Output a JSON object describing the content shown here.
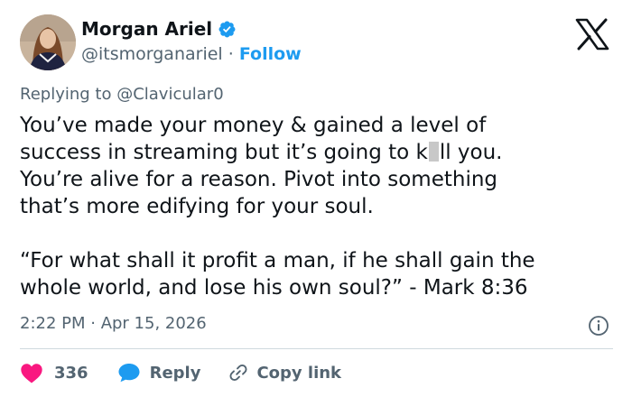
{
  "colors": {
    "accent": "#1d9bf0",
    "text": "#0f1419",
    "secondary": "#536471",
    "like": "#f91880",
    "divider": "#cfd9de"
  },
  "author": {
    "name": "Morgan Ariel",
    "handle": "@itsmorganariel",
    "separator": "·",
    "follow_label": "Follow",
    "verified_icon": "verified-badge-icon",
    "avatar_icon": "avatar"
  },
  "header": {
    "logo_icon": "x-logo-icon"
  },
  "reply_context": "Replying to @Clavicular0",
  "tweet": {
    "lines": [
      {
        "before": "You’ve made your money & gained a level of",
        "after": ""
      },
      {
        "before": "success in streaming but it’s going to k",
        "after": "ll you."
      },
      {
        "before": "You’re alive for a reason. Pivot into something",
        "after": ""
      },
      {
        "before": "that’s more edifying for your soul.",
        "after": ""
      }
    ],
    "quote_lines": [
      "“For what shall it profit a man, if he shall gain the",
      "whole world, and lose his own soul?” - Mark 8:36"
    ]
  },
  "meta": {
    "timestamp": "2:22 PM · Apr 15, 2026",
    "info_icon": "info-icon"
  },
  "actions": {
    "like_count": "336",
    "reply_label": "Reply",
    "copy_label": "Copy link",
    "like_icon": "heart-icon",
    "reply_icon": "speech-bubble-icon",
    "copy_icon": "link-icon"
  }
}
